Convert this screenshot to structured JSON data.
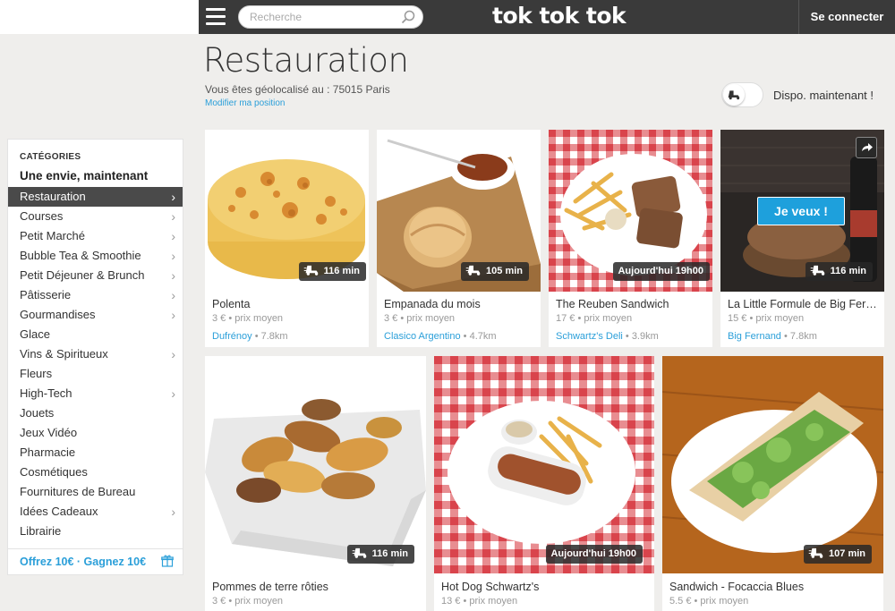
{
  "header": {
    "search_placeholder": "Recherche",
    "logo": "tok tok tok",
    "connect_label": "Se connecter"
  },
  "page": {
    "title": "Restauration",
    "geo_text": "Vous êtes géolocalisé au : 75015 Paris",
    "modify_link": "Modifier ma position",
    "dispo_label": "Dispo. maintenant !"
  },
  "sidebar": {
    "title": "CATÉGORIES",
    "subtitle": "Une envie, maintenant",
    "items": [
      {
        "label": "Restauration",
        "chevron": true,
        "active": true
      },
      {
        "label": "Courses",
        "chevron": true
      },
      {
        "label": "Petit Marché",
        "chevron": true
      },
      {
        "label": "Bubble Tea & Smoothie",
        "chevron": true
      },
      {
        "label": "Petit Déjeuner & Brunch",
        "chevron": true
      },
      {
        "label": "Pâtisserie",
        "chevron": true
      },
      {
        "label": "Gourmandises",
        "chevron": true
      },
      {
        "label": "Glace",
        "chevron": false
      },
      {
        "label": "Vins & Spiritueux",
        "chevron": true
      },
      {
        "label": "Fleurs",
        "chevron": false
      },
      {
        "label": "High-Tech",
        "chevron": true
      },
      {
        "label": "Jouets",
        "chevron": false
      },
      {
        "label": "Jeux Vidéo",
        "chevron": false
      },
      {
        "label": "Pharmacie",
        "chevron": false
      },
      {
        "label": "Cosmétiques",
        "chevron": false
      },
      {
        "label": "Fournitures de Bureau",
        "chevron": false
      },
      {
        "label": "Idées Cadeaux",
        "chevron": true
      },
      {
        "label": "Librairie",
        "chevron": false
      }
    ],
    "chevron_char": "›",
    "footer": "Offrez 10€ · Gagnez 10€"
  },
  "cards": [
    {
      "name": "Polenta",
      "price": "3 € • prix moyen",
      "shop": "Dufrénoy",
      "distance": "• 7.8km",
      "badge": "116 min",
      "badge_icon": true
    },
    {
      "name": "Empanada du mois",
      "price": "3 € • prix moyen",
      "shop": "Clasico Argentino",
      "distance": "• 4.7km",
      "badge": "105 min",
      "badge_icon": true
    },
    {
      "name": "The Reuben Sandwich",
      "price": "17 € • prix moyen",
      "shop": "Schwartz's Deli",
      "distance": "• 3.9km",
      "badge": "Aujourd'hui 19h00",
      "badge_icon": false
    },
    {
      "name": "La Little Formule de Big Fer…",
      "price": "15 € • prix moyen",
      "shop": "Big Fernand",
      "distance": "• 7.8km",
      "badge": "116 min",
      "badge_icon": true,
      "cta": "Je veux !"
    },
    {
      "name": "Pommes de terre rôties",
      "price": "3 € • prix moyen",
      "badge": "116 min",
      "badge_icon": true
    },
    {
      "name": "Hot Dog Schwartz's",
      "price": "13 € • prix moyen",
      "badge": "Aujourd'hui 19h00",
      "badge_icon": false
    },
    {
      "name": "Sandwich - Focaccia Blues",
      "price": "5.5 € • prix moyen",
      "badge": "107 min",
      "badge_icon": true
    }
  ],
  "colors": {
    "accent": "#2b9fd9",
    "topbar": "#3a3a3a",
    "cta": "#1ea0dc"
  }
}
